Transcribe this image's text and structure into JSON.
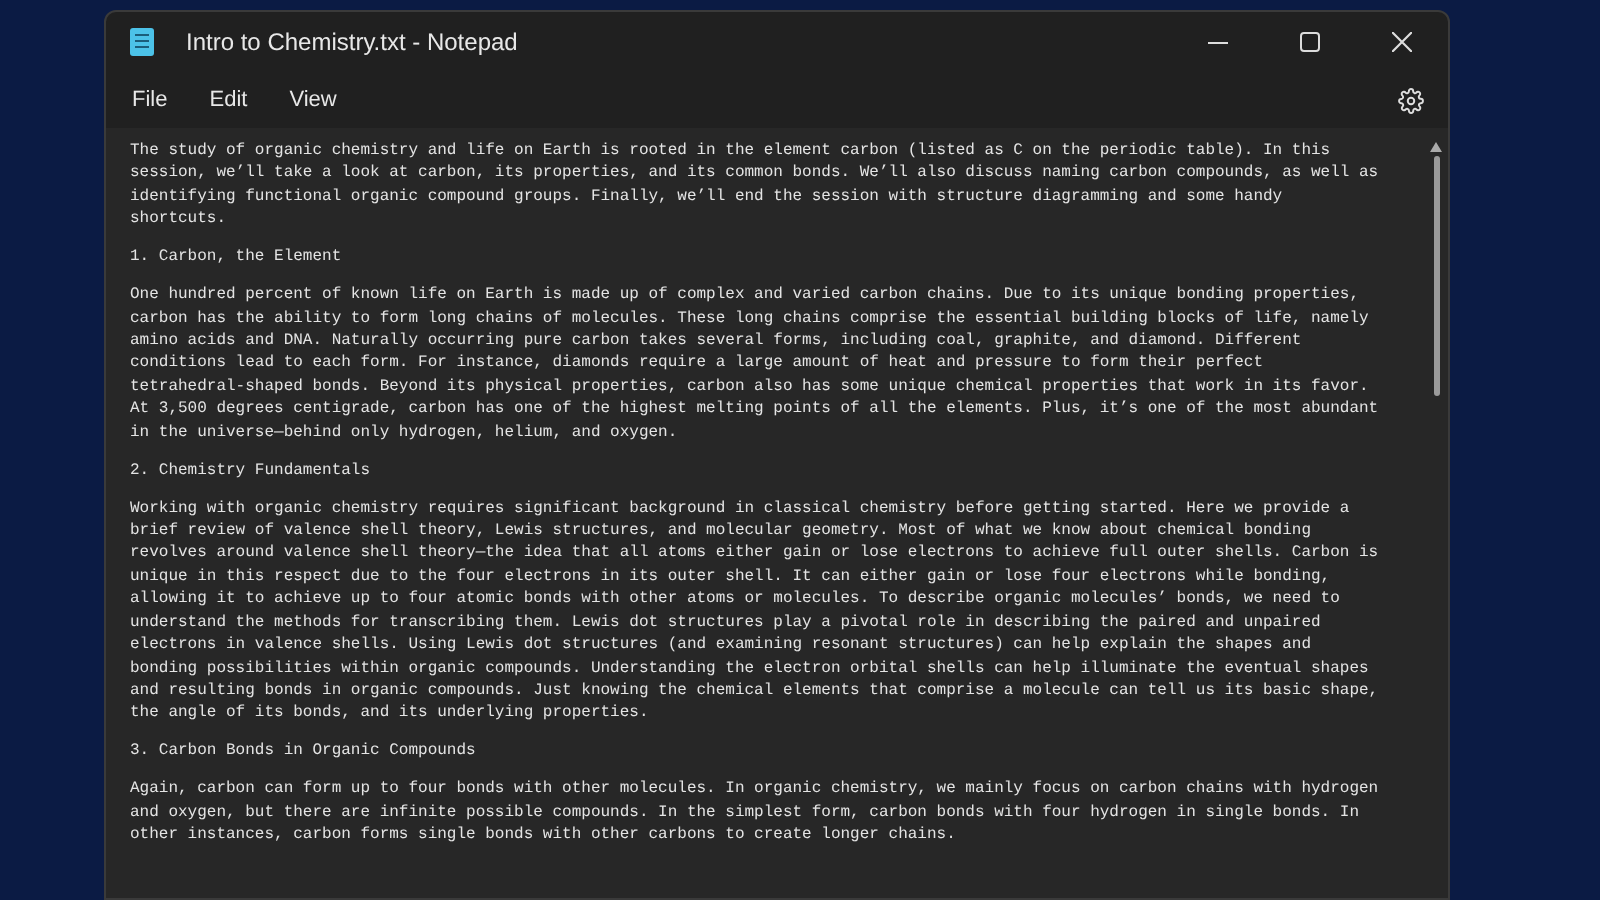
{
  "window": {
    "title": "Intro to Chemistry.txt - Notepad"
  },
  "menu": [
    {
      "label": "File"
    },
    {
      "label": "Edit"
    },
    {
      "label": "View"
    }
  ],
  "document": {
    "paragraphs": [
      {
        "lines": [
          "The study of organic chemistry and life on Earth is rooted in the element carbon (listed as C on the periodic table). In this",
          "session, we’ll take a look at carbon, its properties, and its common bonds. We’ll also discuss naming carbon compounds, as well as",
          "identifying functional organic compound groups. Finally, we’ll end the session with structure diagramming and some handy",
          "shortcuts."
        ]
      },
      {
        "lines": [
          "1. Carbon, the Element"
        ]
      },
      {
        "lines": [
          "One hundred percent of known life on Earth is made up of complex and varied carbon chains. Due to its unique bonding properties,",
          "carbon has the ability to form long chains of molecules. These long chains comprise the essential building blocks of life, namely",
          "amino acids and DNA. Naturally occurring pure carbon takes several forms, including coal, graphite, and diamond. Different",
          "conditions lead to each form. For instance, diamonds require a large amount of heat and pressure to form their perfect",
          "tetrahedral-shaped bonds. Beyond its physical properties, carbon also has some unique chemical properties that work in its favor.",
          "At 3,500 degrees centigrade, carbon has one of the highest melting points of all the elements. Plus, it’s one of the most abundant",
          "in the universe—behind only hydrogen, helium, and oxygen."
        ]
      },
      {
        "lines": [
          "2. Chemistry Fundamentals"
        ]
      },
      {
        "lines": [
          "Working with organic chemistry requires significant background in classical chemistry before getting started. Here we provide a",
          "brief review of valence shell theory, Lewis structures, and molecular geometry. Most of what we know about chemical bonding",
          "revolves around valence shell theory—the idea that all atoms either gain or lose electrons to achieve full outer shells. Carbon is",
          "unique in this respect due to the four electrons in its outer shell. It can either gain or lose four electrons while bonding,",
          "allowing it to achieve up to four atomic bonds with other atoms or molecules. To describe organic molecules’ bonds, we need to",
          "understand the methods for transcribing them. Lewis dot structures play a pivotal role in describing the paired and unpaired",
          "electrons in valence shells. Using Lewis dot structures (and examining resonant structures) can help explain the shapes and",
          "bonding possibilities within organic compounds. Understanding the electron orbital shells can help illuminate the eventual shapes",
          "and resulting bonds in organic compounds. Just knowing the chemical elements that comprise a molecule can tell us its basic shape,",
          "the angle of its bonds, and its underlying properties."
        ]
      },
      {
        "lines": [
          "3. Carbon Bonds in Organic Compounds"
        ]
      },
      {
        "lines": [
          "Again, carbon can form up to four bonds with other molecules. In organic chemistry, we mainly focus on carbon chains with hydrogen",
          "and oxygen, but there are infinite possible compounds. In the simplest form, carbon bonds with four hydrogen in single bonds. In",
          "other instances, carbon forms single bonds with other carbons to create longer chains."
        ]
      }
    ]
  }
}
